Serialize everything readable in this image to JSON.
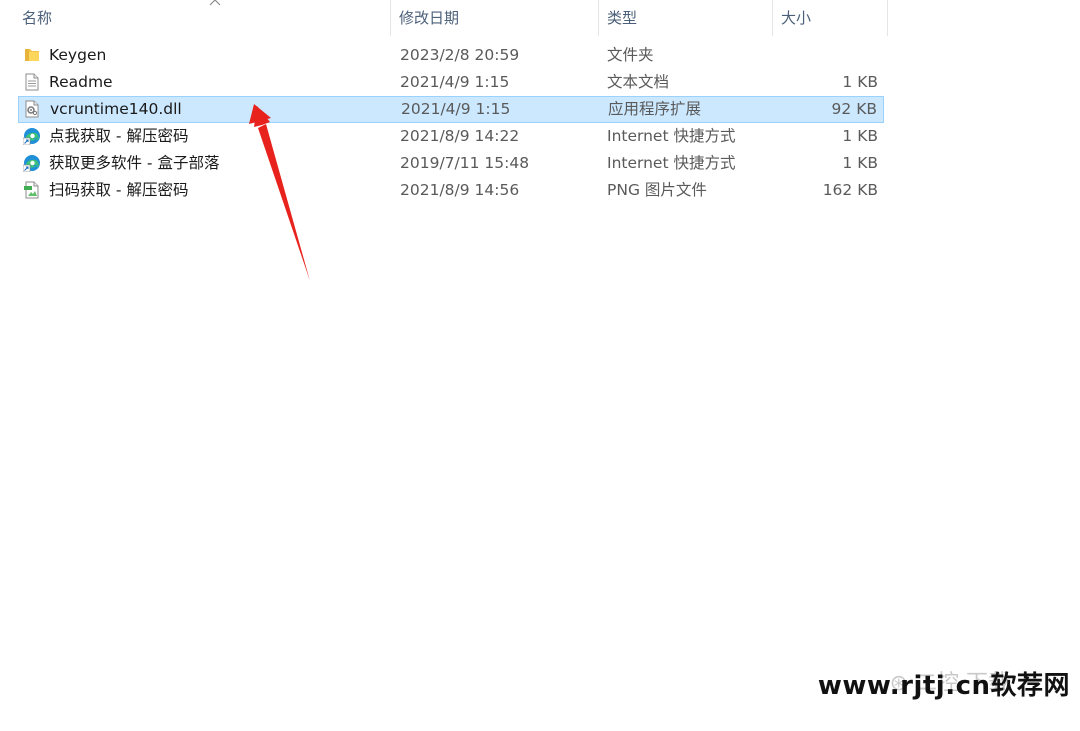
{
  "columns": {
    "name": "名称",
    "date": "修改日期",
    "type": "类型",
    "size": "大小"
  },
  "sort": {
    "column": "name",
    "icon": "sort-up-chevron-icon"
  },
  "files": [
    {
      "name": "Keygen",
      "date": "2023/2/8 20:59",
      "type": "文件夹",
      "size": "",
      "icon": "folder-icon",
      "selected": false
    },
    {
      "name": "Readme",
      "date": "2021/4/9 1:15",
      "type": "文本文档",
      "size": "1 KB",
      "icon": "text-document-icon",
      "selected": false
    },
    {
      "name": "vcruntime140.dll",
      "date": "2021/4/9 1:15",
      "type": "应用程序扩展",
      "size": "92 KB",
      "icon": "dll-file-icon",
      "selected": true
    },
    {
      "name": "点我获取 - 解压密码",
      "date": "2021/8/9 14:22",
      "type": "Internet 快捷方式",
      "size": "1 KB",
      "icon": "edge-shortcut-icon",
      "selected": false
    },
    {
      "name": "获取更多软件 - 盒子部落",
      "date": "2019/7/11 15:48",
      "type": "Internet 快捷方式",
      "size": "1 KB",
      "icon": "edge-shortcut-icon",
      "selected": false
    },
    {
      "name": "扫码获取 - 解压密码",
      "date": "2021/8/9 14:56",
      "type": "PNG 图片文件",
      "size": "162 KB",
      "icon": "png-image-icon",
      "selected": false
    }
  ],
  "colors": {
    "selection_bg": "#cce8ff",
    "selection_border": "#99d1ff",
    "arrow": "#e8231e",
    "folder": "#f6c444"
  },
  "watermark": {
    "text": "www.rjtj.cn软荐网"
  }
}
